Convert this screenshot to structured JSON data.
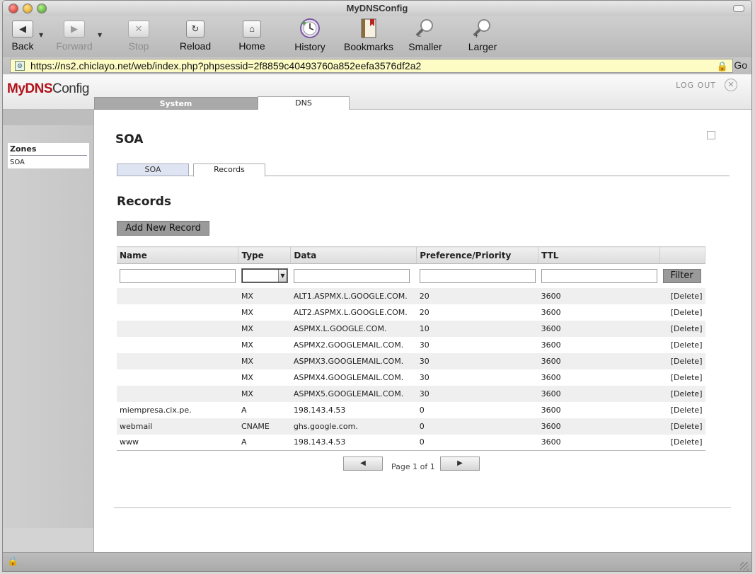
{
  "window": {
    "title": "MyDNSConfig"
  },
  "toolbar": {
    "back": "Back",
    "forward": "Forward",
    "stop": "Stop",
    "reload": "Reload",
    "home": "Home",
    "history": "History",
    "bookmarks": "Bookmarks",
    "smaller": "Smaller",
    "larger": "Larger"
  },
  "urlbar": {
    "url": "https://ns2.chiclayo.net/web/index.php?phpsessid=2f8859c40493760a852eefa3576df2a2",
    "go": "Go"
  },
  "header": {
    "logo_part1": "MyDNS",
    "logo_part2": "Config",
    "logout": "LOG OUT",
    "tabs": {
      "system": "System",
      "dns": "DNS"
    }
  },
  "sidebar": {
    "title": "Zones",
    "items": [
      "SOA"
    ]
  },
  "content": {
    "title": "SOA",
    "subtabs": {
      "soa": "SOA",
      "records": "Records"
    },
    "records_title": "Records",
    "add_button": "Add New Record",
    "columns": {
      "name": "Name",
      "type": "Type",
      "data": "Data",
      "pref": "Preference/Priority",
      "ttl": "TTL"
    },
    "filter_button": "Filter",
    "rows": [
      {
        "name": "",
        "type": "MX",
        "data": "ALT1.ASPMX.L.GOOGLE.COM.",
        "pref": "20",
        "ttl": "3600",
        "action": "[Delete]"
      },
      {
        "name": "",
        "type": "MX",
        "data": "ALT2.ASPMX.L.GOOGLE.COM.",
        "pref": "20",
        "ttl": "3600",
        "action": "[Delete]"
      },
      {
        "name": "",
        "type": "MX",
        "data": "ASPMX.L.GOOGLE.COM.",
        "pref": "10",
        "ttl": "3600",
        "action": "[Delete]"
      },
      {
        "name": "",
        "type": "MX",
        "data": "ASPMX2.GOOGLEMAIL.COM.",
        "pref": "30",
        "ttl": "3600",
        "action": "[Delete]"
      },
      {
        "name": "",
        "type": "MX",
        "data": "ASPMX3.GOOGLEMAIL.COM.",
        "pref": "30",
        "ttl": "3600",
        "action": "[Delete]"
      },
      {
        "name": "",
        "type": "MX",
        "data": "ASPMX4.GOOGLEMAIL.COM.",
        "pref": "30",
        "ttl": "3600",
        "action": "[Delete]"
      },
      {
        "name": "",
        "type": "MX",
        "data": "ASPMX5.GOOGLEMAIL.COM.",
        "pref": "30",
        "ttl": "3600",
        "action": "[Delete]"
      },
      {
        "name": "miempresa.cix.pe.",
        "type": "A",
        "data": "198.143.4.53",
        "pref": "0",
        "ttl": "3600",
        "action": "[Delete]"
      },
      {
        "name": "webmail",
        "type": "CNAME",
        "data": "ghs.google.com.",
        "pref": "0",
        "ttl": "3600",
        "action": "[Delete]"
      },
      {
        "name": "www",
        "type": "A",
        "data": "198.143.4.53",
        "pref": "0",
        "ttl": "3600",
        "action": "[Delete]"
      }
    ],
    "pager": {
      "text": "Page 1 of 1"
    }
  }
}
